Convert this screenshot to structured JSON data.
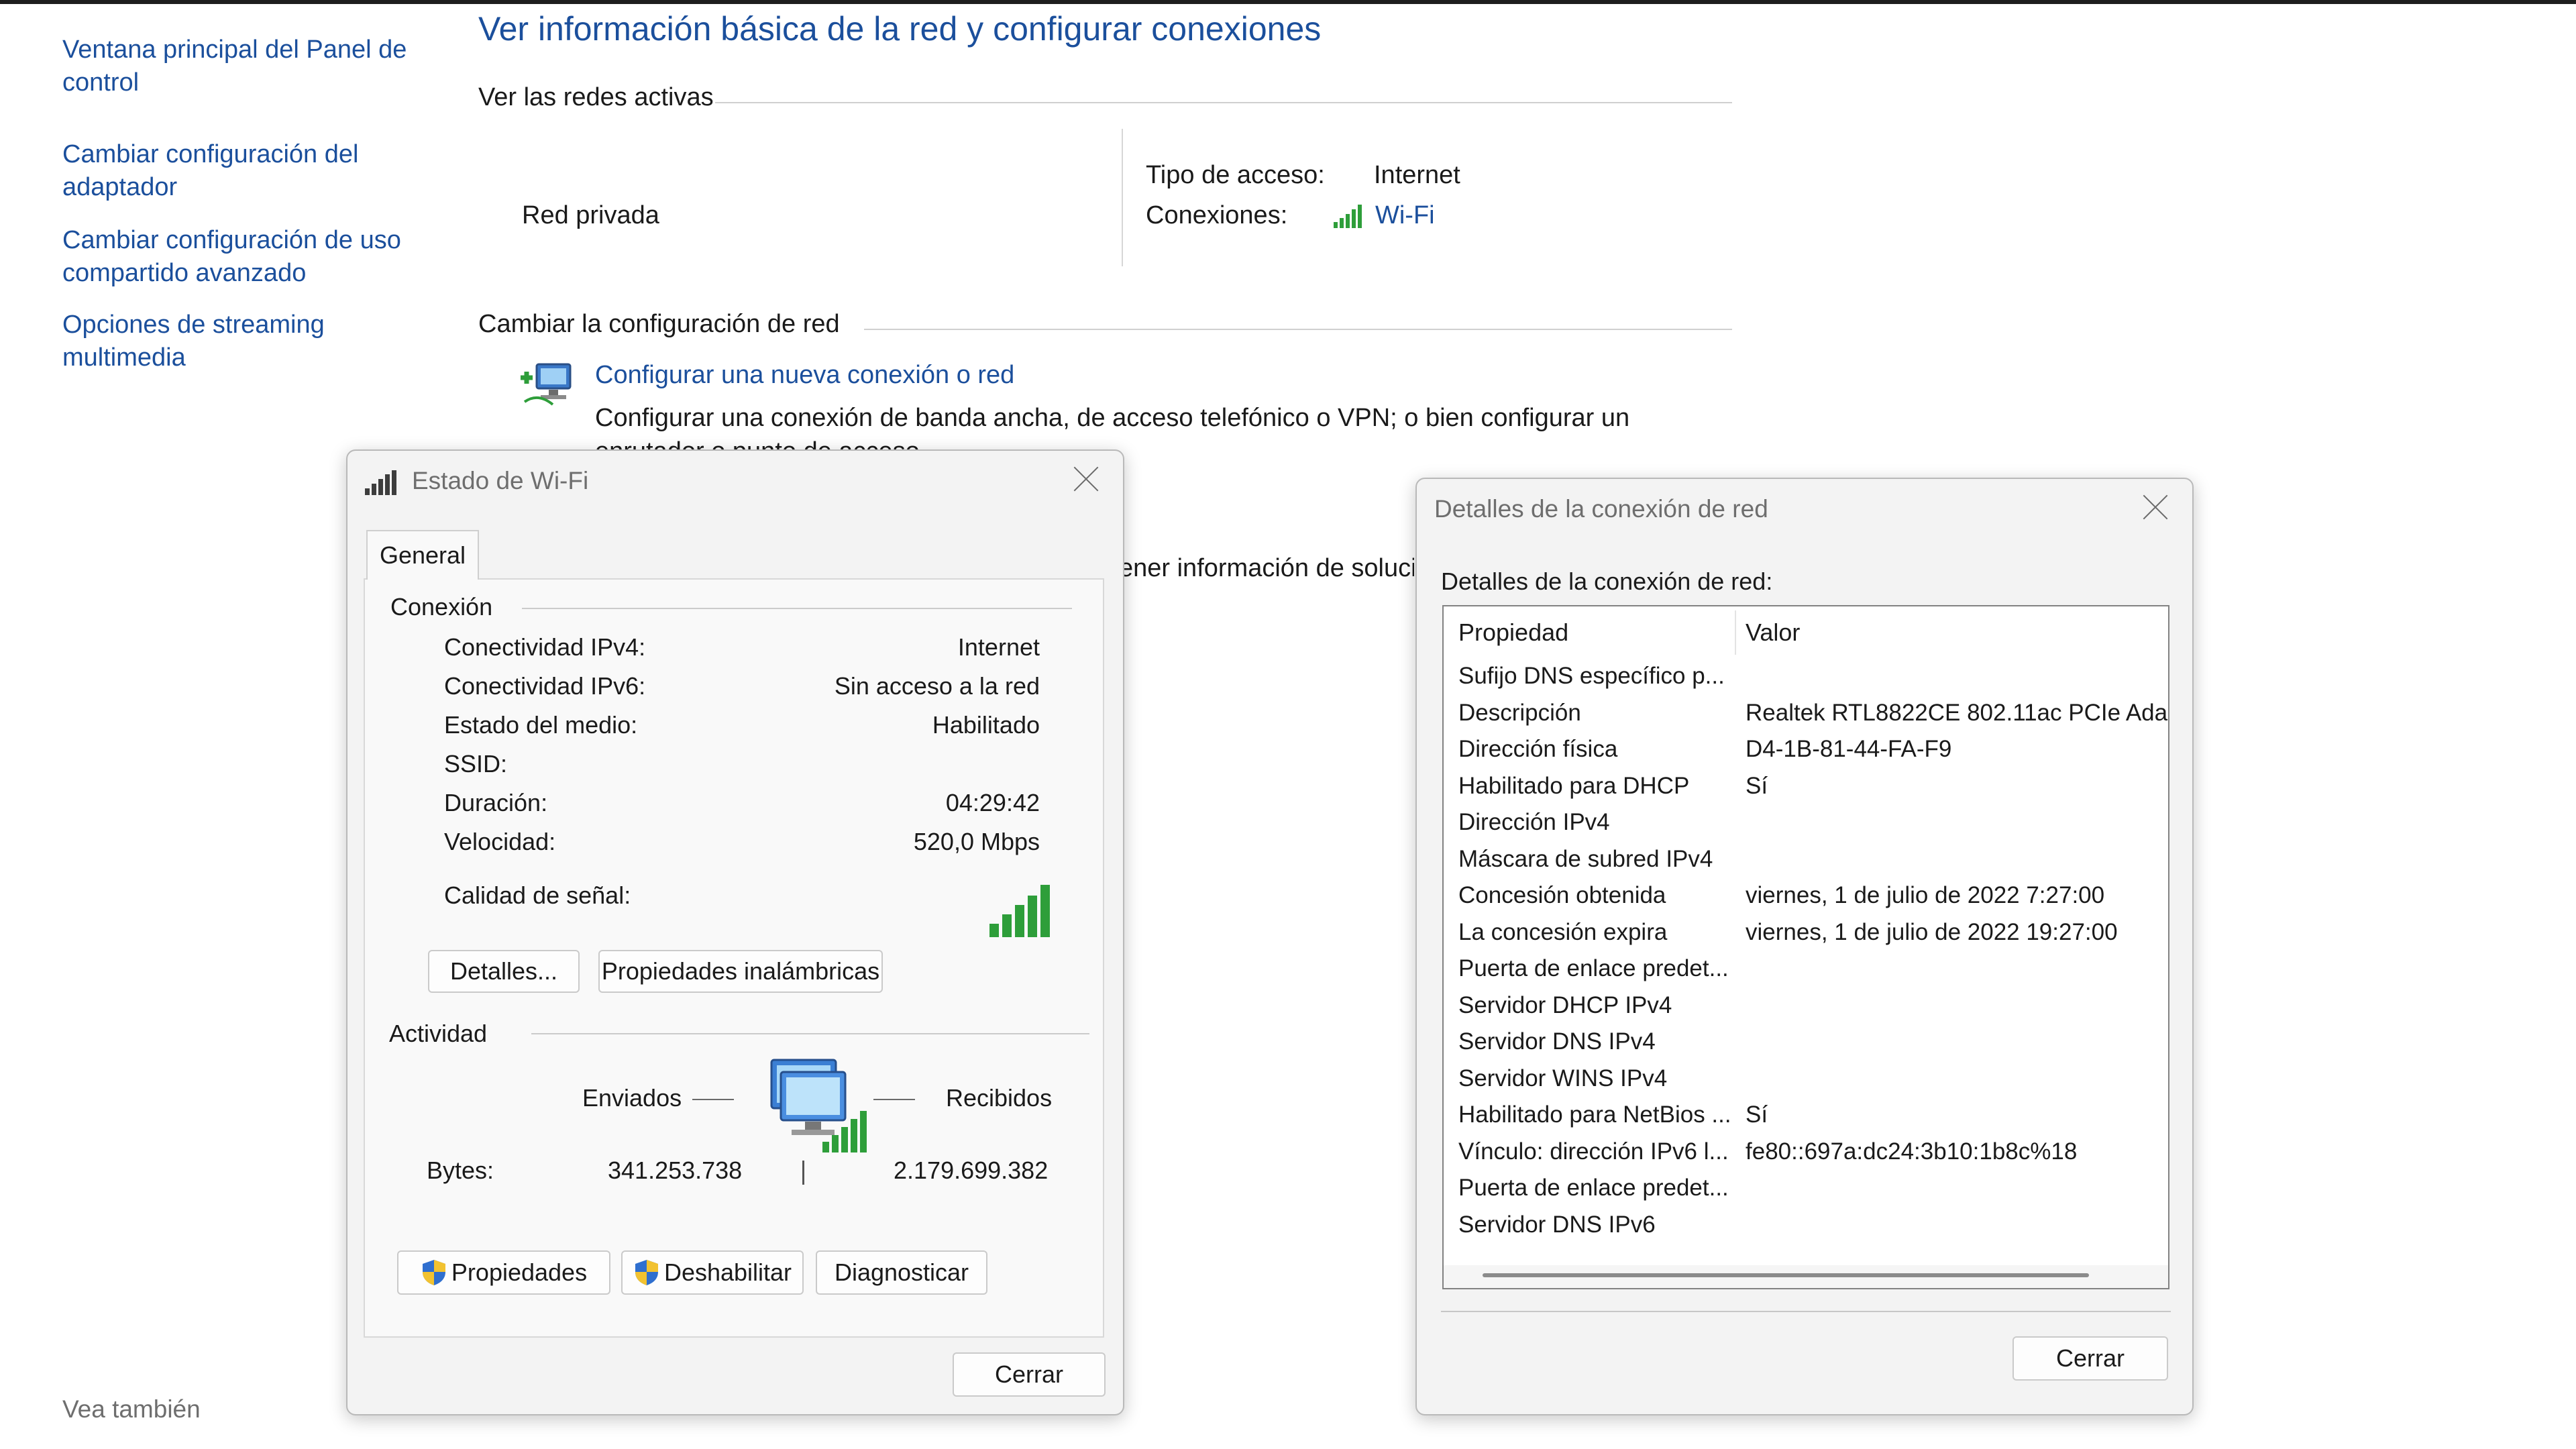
{
  "control_panel": {
    "nav": [
      "Ventana principal del Panel de control",
      "Cambiar configuración del adaptador",
      "Cambiar configuración de uso compartido avanzado",
      "Opciones de streaming multimedia"
    ],
    "see_also": "Vea también",
    "title": "Ver información básica de la red y configurar conexiones",
    "active_networks_header": "Ver las redes activas",
    "network_name": "Red privada",
    "access_type_label": "Tipo de acceso:",
    "access_type_value": "Internet",
    "connections_label": "Conexiones:",
    "connection_value": "Wi-Fi",
    "change_settings_header": "Cambiar la configuración de red",
    "setup_link": "Configurar una nueva conexión o red",
    "setup_desc": "Configurar una conexión de banda ancha, de acceso telefónico o VPN; o bien configurar un",
    "setup_desc2": "enrutador o punto de acceso.",
    "troubleshoot_partial": "ener información de soluci"
  },
  "wifi_status": {
    "title": "Estado de Wi-Fi",
    "tab": "General",
    "connection_group": "Conexión",
    "rows": [
      {
        "label": "Conectividad IPv4:",
        "value": "Internet"
      },
      {
        "label": "Conectividad IPv6:",
        "value": "Sin acceso a la red"
      },
      {
        "label": "Estado del medio:",
        "value": "Habilitado"
      },
      {
        "label": "SSID:",
        "value": ""
      },
      {
        "label": "Duración:",
        "value": "04:29:42"
      },
      {
        "label": "Velocidad:",
        "value": "520,0 Mbps"
      }
    ],
    "signal_label": "Calidad de señal:",
    "details_button": "Detalles...",
    "wireless_props_button": "Propiedades inalámbricas",
    "activity_group": "Actividad",
    "sent_label": "Enviados",
    "received_label": "Recibidos",
    "bytes_label": "Bytes:",
    "bytes_sent": "341.253.738",
    "bytes_received": "2.179.699.382",
    "properties_button": "Propiedades",
    "disable_button": "Deshabilitar",
    "diagnose_button": "Diagnosticar",
    "close_button": "Cerrar"
  },
  "net_details": {
    "title": "Detalles de la conexión de red",
    "caption": "Detalles de la conexión de red:",
    "col_property": "Propiedad",
    "col_value": "Valor",
    "rows": [
      {
        "p": "Sufijo DNS específico p...",
        "v": ""
      },
      {
        "p": "Descripción",
        "v": "Realtek RTL8822CE 802.11ac PCIe Ada"
      },
      {
        "p": "Dirección física",
        "v": "D4-1B-81-44-FA-F9"
      },
      {
        "p": "Habilitado para DHCP",
        "v": "Sí"
      },
      {
        "p": "Dirección IPv4",
        "v": ""
      },
      {
        "p": "Máscara de subred IPv4",
        "v": ""
      },
      {
        "p": "Concesión obtenida",
        "v": "viernes, 1 de julio de 2022 7:27:00"
      },
      {
        "p": "La concesión expira",
        "v": "viernes, 1 de julio de 2022 19:27:00"
      },
      {
        "p": "Puerta de enlace predet...",
        "v": ""
      },
      {
        "p": "Servidor DHCP IPv4",
        "v": ""
      },
      {
        "p": "Servidor DNS IPv4",
        "v": ""
      },
      {
        "p": "Servidor WINS IPv4",
        "v": ""
      },
      {
        "p": "Habilitado para NetBios ...",
        "v": "Sí"
      },
      {
        "p": "Vínculo: dirección IPv6 l...",
        "v": "fe80::697a:dc24:3b10:1b8c%18"
      },
      {
        "p": "Puerta de enlace predet...",
        "v": ""
      },
      {
        "p": "Servidor DNS IPv6",
        "v": ""
      }
    ],
    "close_button": "Cerrar"
  },
  "colors": {
    "link": "#1b4f9c",
    "signal": "#2e9e3a",
    "shield_blue": "#2f6fcf",
    "shield_yellow": "#f2c230"
  }
}
